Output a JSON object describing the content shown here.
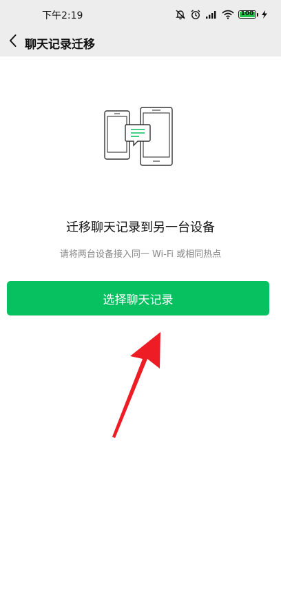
{
  "status_bar": {
    "time": "下午2:19",
    "battery_level": "100",
    "battery_fraction": 1.0,
    "icons": [
      "mute-icon",
      "alarm-icon",
      "signal-icon",
      "wifi-icon",
      "battery-icon",
      "charging-icon"
    ]
  },
  "nav": {
    "back_icon": "chevron-left-icon",
    "title": "聊天记录迁移"
  },
  "main": {
    "illustration": "two-phones-transfer-icon",
    "heading": "迁移聊天记录到另一台设备",
    "subtext": "请将两台设备接入同一 Wi-Fi 或相同热点",
    "select_button_label": "选择聊天记录"
  },
  "colors": {
    "primary": "#07c160",
    "nav_background": "#ededed",
    "annotation_arrow": "#ee1c25"
  }
}
